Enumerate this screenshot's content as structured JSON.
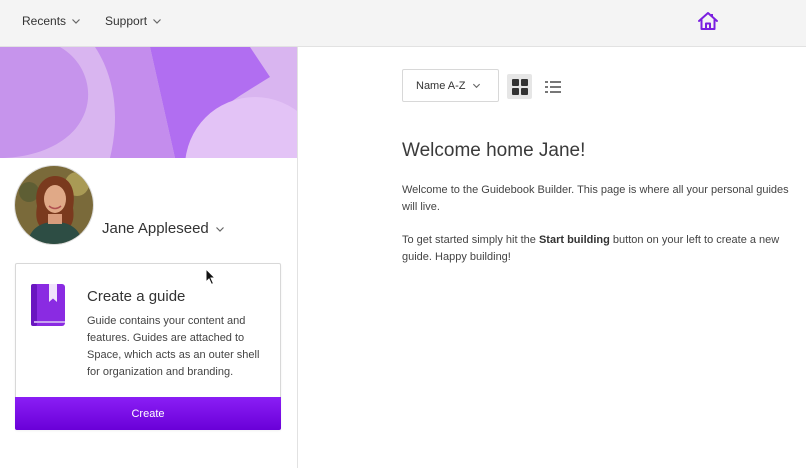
{
  "topbar": {
    "recents_label": "Recents",
    "support_label": "Support",
    "home_icon": "home-icon",
    "home_icon_color": "#7b1fe0"
  },
  "sidebar": {
    "user_name": "Jane Appleseed",
    "banner_color": "#d9b5f0",
    "create_card": {
      "title": "Create a guide",
      "description": "Guide contains your content and features. Guides are attached to Space, which acts as an outer shell for organization and branding.",
      "button_label": "Create",
      "icon": "book-icon",
      "accent_color": "#6a00d8"
    }
  },
  "main": {
    "sort_label": "Name A-Z",
    "view_grid_icon": "grid-view-icon",
    "view_list_icon": "list-view-icon",
    "title": "Welcome home Jane!",
    "paragraph1": "Welcome to the Guidebook Builder. This page is where all your personal guides will live.",
    "paragraph2_before": "To get started simply hit the ",
    "paragraph2_bold": "Start building",
    "paragraph2_after": " button on your left to create a new guide. Happy building!"
  }
}
